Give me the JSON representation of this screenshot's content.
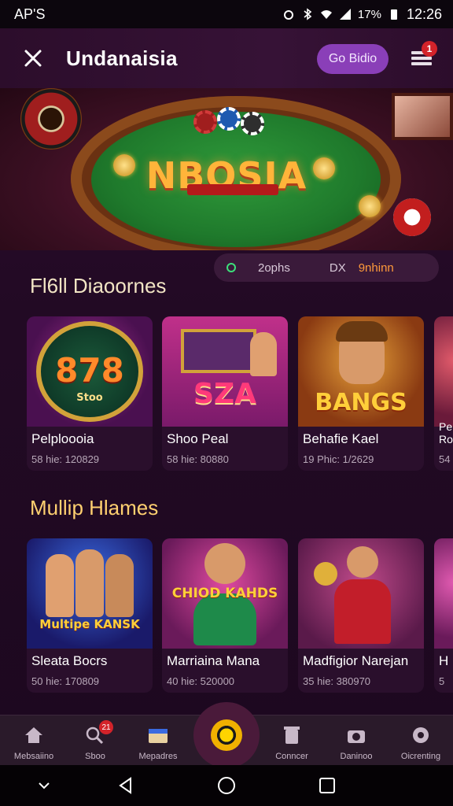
{
  "status_bar": {
    "left_text": "AP'S",
    "battery": "17%",
    "time": "12:26"
  },
  "app_bar": {
    "title": "Undanaisia",
    "go_button": "Go Bidio",
    "menu_badge": "1",
    "close_icon": "close-icon",
    "menu_icon": "stack-menu-icon"
  },
  "hero": {
    "title": "NBOSIA"
  },
  "filter_strip": {
    "item_a": "2ophs",
    "item_b": "DX",
    "item_c": "9nhinn"
  },
  "section_1": {
    "title": "Fl6ll Diaoornes",
    "cards": [
      {
        "logo": "878",
        "sublogo": "Stoo",
        "name": "Pelploooia",
        "meta": "58 hie: 120829"
      },
      {
        "logo": "SZA",
        "sublogo": "",
        "name": "Shoo Peal",
        "meta": "58 hie: 80880"
      },
      {
        "logo": "BANGS",
        "sublogo": "",
        "name": "Behafie Kael",
        "meta": "19 Phic: 1/2629"
      },
      {
        "logo": "",
        "sublogo": "",
        "name": "Pe Ro",
        "meta": "54"
      }
    ]
  },
  "section_2": {
    "title": "Mullip Hlames",
    "cards": [
      {
        "logo": "Multipe KANSK",
        "name": "Sleata Bocrs",
        "meta": "50 hie: 170809"
      },
      {
        "logo": "CHIOD KAHDS",
        "name": "Marriaina Mana",
        "meta": "40 hie: 520000"
      },
      {
        "logo": "",
        "name": "Madfigior Narejan",
        "meta": "35 hie: 380970"
      },
      {
        "logo": "",
        "name": "H",
        "meta": "5"
      }
    ]
  },
  "bottom_nav": {
    "items": [
      {
        "label": "Mebsaiino",
        "icon": "home-icon"
      },
      {
        "label": "Sboo",
        "icon": "search-icon",
        "badge": "21"
      },
      {
        "label": "Mepadres",
        "icon": "cards-icon"
      },
      {
        "label": "",
        "icon": "center-play-icon"
      },
      {
        "label": "Conncer",
        "icon": "trash-icon"
      },
      {
        "label": "Daninoo",
        "icon": "camera-icon"
      },
      {
        "label": "Oicrenting",
        "icon": "settings-icon"
      }
    ]
  },
  "colors": {
    "accent": "#8a3fb8",
    "badge": "#d3232a",
    "gold": "#ffd070"
  }
}
